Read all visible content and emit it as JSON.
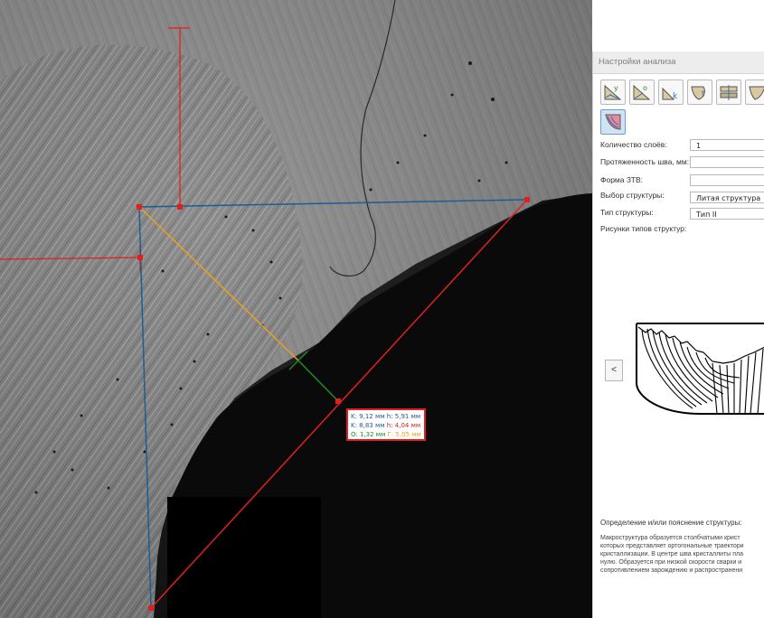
{
  "measurement": {
    "line1": {
      "k_label": "K: 9,12 мм",
      "h_label": "h: 5,91 мм"
    },
    "line2": {
      "k_label": "K: 8,83 мм",
      "h_label": "h: 4,04 мм"
    },
    "line3": {
      "o_label": "O: 1,32 мм",
      "extra_label": "Г: 5,05 мм"
    },
    "colors": {
      "red": "#e02020",
      "blue": "#1f5c8f",
      "orange": "#e8a020",
      "green": "#1a8a2a"
    }
  },
  "panel": {
    "title": "Настройки анализа",
    "toolbar_icons": [
      "weld-y-icon",
      "weld-o-icon",
      "weld-k-icon",
      "weld-t-icon",
      "weld-layers-icon",
      "weld-shape-icon",
      "weld-structure-icon"
    ],
    "fields": {
      "layers": {
        "label": "Количество слоёв:",
        "value": "1"
      },
      "length": {
        "label": "Протяженность шва, мм:",
        "value": ""
      },
      "haz_shape": {
        "label": "Форма ЗТВ:",
        "value": ""
      },
      "structure_choice": {
        "label": "Выбор структуры:",
        "value": "Литая структура"
      },
      "structure_type": {
        "label": "Тип структуры:",
        "value": "Тип II"
      }
    },
    "pictures_label": "Рисунки типов структур:",
    "prev_button": "<",
    "definition_label": "Определение и/или пояснение структуры:",
    "definition_lines": [
      "Макроструктура образуется столбчатыми крист",
      "которых представляет ортогональные траектори",
      "кристаллизации. В центре шва кристаллиты пла",
      "нулю. Образуется при низкой скорости сварки и",
      "сопротивлением зарождению и распространени"
    ]
  }
}
